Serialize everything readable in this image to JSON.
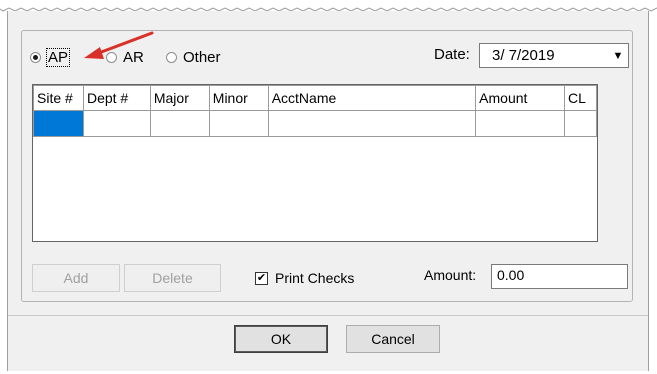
{
  "mode": {
    "options": [
      {
        "label": "AP",
        "checked": true
      },
      {
        "label": "AR",
        "checked": false
      },
      {
        "label": "Other",
        "checked": false
      }
    ]
  },
  "date": {
    "label": "Date:",
    "value": "3/ 7/2019"
  },
  "grid": {
    "columns": [
      "Site #",
      "Dept #",
      "Major",
      "Minor",
      "AcctName",
      "Amount",
      "CL"
    ]
  },
  "buttons": {
    "add": "Add",
    "delete": "Delete",
    "ok": "OK",
    "cancel": "Cancel"
  },
  "print_checks": {
    "label": "Print Checks",
    "checked": true
  },
  "amount": {
    "label": "Amount:",
    "value": "0.00"
  },
  "colors": {
    "selection": "#0078d7",
    "arrow": "#d9302a"
  }
}
